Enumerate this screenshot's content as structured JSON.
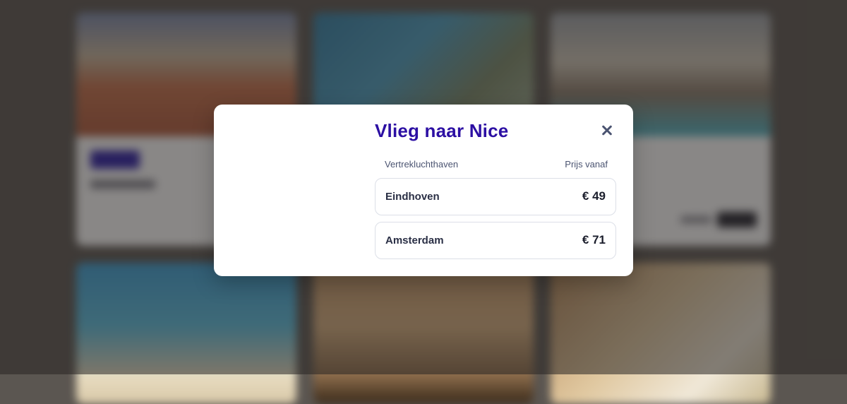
{
  "modal": {
    "title": "Vlieg naar Nice",
    "column_departure": "Vertrekluchthaven",
    "column_price": "Prijs vanaf",
    "rows": [
      {
        "airport": "Eindhoven",
        "price": "€ 49"
      },
      {
        "airport": "Amsterdam",
        "price": "€ 71"
      }
    ]
  },
  "colors": {
    "title": "#2c0fa3",
    "overlay": "rgba(40,36,34,0.55)"
  },
  "icons": {
    "close": "close-icon"
  }
}
